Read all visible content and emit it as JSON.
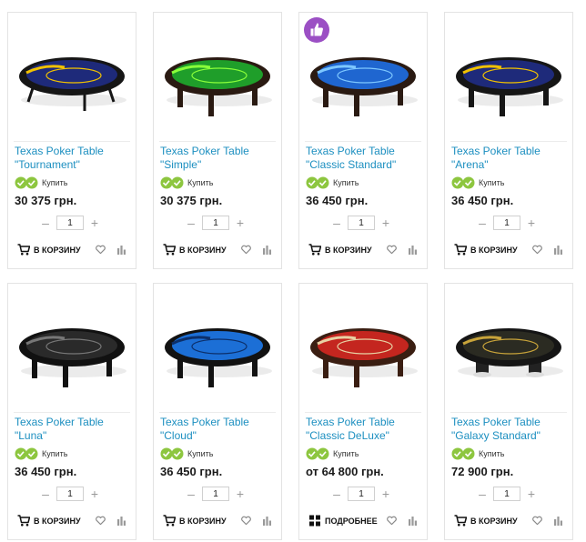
{
  "labels": {
    "stock": "Купить",
    "cart": "В КОРЗИНУ",
    "more": "ПОДРОБНЕЕ",
    "qty_minus": "–",
    "qty_plus": "+"
  },
  "colors": {
    "link": "#1c8fc0",
    "stock_green": "#8dc63f",
    "badge_purple": "#9b4fc4"
  },
  "products": [
    {
      "title_line1": "Texas Poker Table",
      "title_line2": "\"Tournament\"",
      "price": "30 375 грн.",
      "qty": "1",
      "action": "cart",
      "felt": "#1e2a7a",
      "accent": "#f2c200",
      "frame": "#161616",
      "legs": "folding",
      "badge": false
    },
    {
      "title_line1": "Texas Poker Table",
      "title_line2": "\"Simple\"",
      "price": "30 375 грн.",
      "qty": "1",
      "action": "cart",
      "felt": "#1f9e2a",
      "accent": "#8aff3a",
      "frame": "#2a1a12",
      "legs": "wood",
      "badge": false
    },
    {
      "title_line1": "Texas Poker Table",
      "title_line2": "\"Classic Standard\"",
      "price": "36 450 грн.",
      "qty": "1",
      "action": "cart",
      "felt": "#1f66d0",
      "accent": "#7ec8ff",
      "frame": "#2a1a12",
      "legs": "wood",
      "badge": true
    },
    {
      "title_line1": "Texas Poker Table",
      "title_line2": "\"Arena\"",
      "price": "36 450 грн.",
      "qty": "1",
      "action": "cart",
      "felt": "#1e2a7a",
      "accent": "#f2c200",
      "frame": "#161616",
      "legs": "wood",
      "badge": false
    },
    {
      "title_line1": "Texas Poker Table",
      "title_line2": "\"Luna\"",
      "price": "36 450 грн.",
      "qty": "1",
      "action": "cart",
      "felt": "#2a2a2a",
      "accent": "#777777",
      "frame": "#111111",
      "legs": "wood",
      "badge": false
    },
    {
      "title_line1": "Texas Poker Table",
      "title_line2": "\"Cloud\"",
      "price": "36 450 грн.",
      "qty": "1",
      "action": "cart",
      "felt": "#1c6fd6",
      "accent": "#0c2f6a",
      "frame": "#121212",
      "legs": "wood",
      "badge": false
    },
    {
      "title_line1": "Texas Poker Table",
      "title_line2": "\"Classic DeLuxe\"",
      "price": "от 64 800 грн.",
      "qty": "1",
      "action": "more",
      "felt": "#c4261f",
      "accent": "#e8d2a4",
      "frame": "#3a1e12",
      "legs": "wood",
      "badge": false
    },
    {
      "title_line1": "Texas Poker Table",
      "title_line2": "\"Galaxy Standard\"",
      "price": "72 900 грн.",
      "qty": "1",
      "action": "cart",
      "felt": "#2b2b22",
      "accent": "#c9a43a",
      "frame": "#151515",
      "legs": "pedestal",
      "badge": false
    }
  ]
}
